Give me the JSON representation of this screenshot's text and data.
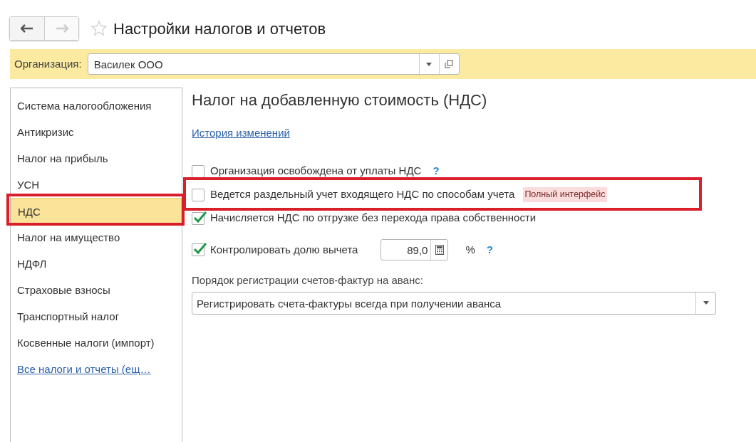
{
  "window": {
    "title": "Настройки налогов и отчетов",
    "favorite": false
  },
  "organization": {
    "label": "Организация:",
    "value": "Василек ООО"
  },
  "sidebar": {
    "items": [
      {
        "label": "Система налогообложения",
        "selected": false,
        "highlighted": false
      },
      {
        "label": "Антикризис",
        "selected": false,
        "highlighted": false
      },
      {
        "label": "Налог на прибыль",
        "selected": false,
        "highlighted": false
      },
      {
        "label": "УСН",
        "selected": false,
        "highlighted": false
      },
      {
        "label": "НДС",
        "selected": true,
        "highlighted": true
      },
      {
        "label": "Налог на имущество",
        "selected": false,
        "highlighted": false
      },
      {
        "label": "НДФЛ",
        "selected": false,
        "highlighted": false
      },
      {
        "label": "Страховые взносы",
        "selected": false,
        "highlighted": false
      },
      {
        "label": "Транспортный налог",
        "selected": false,
        "highlighted": false
      },
      {
        "label": "Косвенные налоги (импорт)",
        "selected": false,
        "highlighted": false
      }
    ],
    "more_link": "Все налоги и отчеты (ещ…"
  },
  "section": {
    "title": "Налог на добавленную стоимость (НДС)",
    "history_link": "История изменений",
    "options": [
      {
        "kind": "checkbox",
        "label": "Организация освобождена от уплаты НДС",
        "checked": false,
        "help": "?",
        "highlighted": false
      },
      {
        "kind": "checkbox",
        "label": "Ведется раздельный учет входящего НДС по способам учета",
        "checked": false,
        "tag": "Полный интерфейс",
        "highlighted": true
      },
      {
        "kind": "checkbox",
        "label": "Начисляется НДС по отгрузке без перехода права собственности",
        "checked": true,
        "highlighted": false
      },
      {
        "kind": "number",
        "label": "Контролировать долю вычета",
        "checked": true,
        "value": "89,0",
        "unit": "%",
        "help": "?",
        "highlighted": false
      }
    ],
    "invoice_order": {
      "label": "Порядок регистрации счетов-фактур на аванс:",
      "value": "Регистрировать счета-фактуры всегда при получении аванса"
    }
  }
}
